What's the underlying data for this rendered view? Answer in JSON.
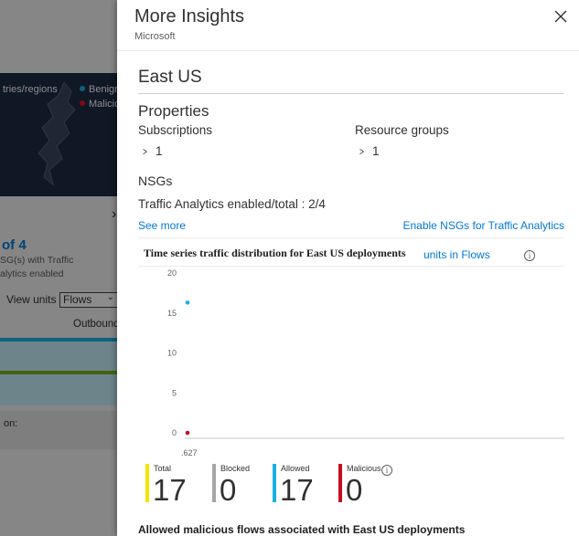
{
  "background": {
    "map_label": "tries/regions",
    "legend": [
      {
        "label": "Benign",
        "color": "#1aafe6"
      },
      {
        "label": "Malicio",
        "color": "#e81123"
      }
    ],
    "nsg_count": "of 4",
    "nsg_text_1": "SG(s) with Traffic",
    "nsg_text_2": "alytics enabled",
    "view_units_label": "View units :",
    "view_units_value": "Flows",
    "outbound_label": "Outbound",
    "on_label": "on:"
  },
  "panel": {
    "title": "More Insights",
    "subtitle": "Microsoft",
    "region": "East US",
    "properties_heading": "Properties",
    "subscriptions_label": "Subscriptions",
    "subscriptions_value": "1",
    "resource_groups_label": "Resource groups",
    "resource_groups_value": "1",
    "nsgs_heading": "NSGs",
    "traffic_analytics_text": "Traffic Analytics enabled/total : 2/4",
    "see_more": "See more",
    "enable_nsgs": "Enable NSGs for Traffic Analytics",
    "chart_title": "Time series traffic distribution for East US deployments",
    "chart_units": "units in Flows",
    "stats": [
      {
        "label": "Total",
        "value": "17",
        "color": "#f2e600"
      },
      {
        "label": "Blocked",
        "value": "0",
        "color": "#a6a6a6"
      },
      {
        "label": "Allowed",
        "value": "17",
        "color": "#1aafe6"
      },
      {
        "label": "Malicious",
        "value": "0",
        "color": "#c50f1f"
      }
    ],
    "bottom_title": "Allowed malicious flows associated with East US deployments"
  },
  "chart_data": {
    "type": "scatter",
    "title": "Time series traffic distribution for East US deployments",
    "y_ticks": [
      "20",
      "15",
      "10",
      "5",
      "0"
    ],
    "x_tick": ".627",
    "ylim": [
      0,
      20
    ],
    "series": [
      {
        "color": "#1aafe6",
        "points": [
          {
            "y": 16.3
          }
        ]
      },
      {
        "color": "#c50f1f",
        "points": [
          {
            "y": 0
          }
        ]
      }
    ]
  }
}
